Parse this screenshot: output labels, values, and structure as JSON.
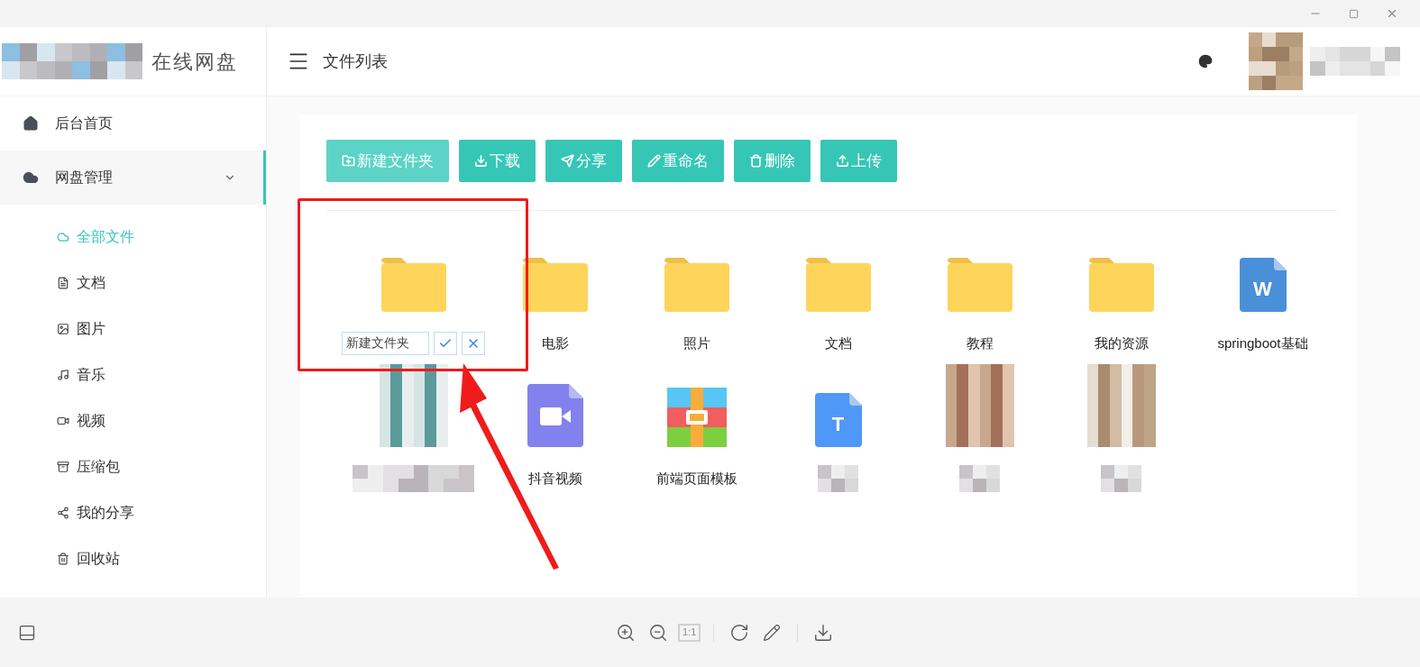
{
  "app": {
    "logo_text": "在线网盘"
  },
  "header": {
    "title": "文件列表"
  },
  "sidebar": {
    "items": [
      {
        "label": "后台首页",
        "selected": false
      },
      {
        "label": "网盘管理",
        "selected": true,
        "expanded": true,
        "children": [
          {
            "label": "全部文件",
            "selected": true
          },
          {
            "label": "文档",
            "selected": false
          },
          {
            "label": "图片",
            "selected": false
          },
          {
            "label": "音乐",
            "selected": false
          },
          {
            "label": "视频",
            "selected": false
          },
          {
            "label": "压缩包",
            "selected": false
          },
          {
            "label": "我的分享",
            "selected": false
          },
          {
            "label": "回收站",
            "selected": false
          }
        ]
      }
    ]
  },
  "toolbar": [
    {
      "label": "新建文件夹",
      "hovered": true
    },
    {
      "label": "下载",
      "hovered": false
    },
    {
      "label": "分享",
      "hovered": false
    },
    {
      "label": "重命名",
      "hovered": false
    },
    {
      "label": "删除",
      "hovered": false
    },
    {
      "label": "上传",
      "hovered": false
    }
  ],
  "files": [
    {
      "kind": "folder",
      "name": "新建文件夹",
      "editing": true,
      "name_hidden": false
    },
    {
      "kind": "folder",
      "name": "电影",
      "editing": false,
      "name_hidden": false
    },
    {
      "kind": "folder",
      "name": "照片",
      "editing": false,
      "name_hidden": false
    },
    {
      "kind": "folder",
      "name": "文档",
      "editing": false,
      "name_hidden": false
    },
    {
      "kind": "folder",
      "name": "教程",
      "editing": false,
      "name_hidden": false
    },
    {
      "kind": "folder",
      "name": "我的资源",
      "editing": false,
      "name_hidden": false
    },
    {
      "kind": "word",
      "badge": "W",
      "name": "springboot基础",
      "editing": false,
      "name_hidden": false
    },
    {
      "kind": "image",
      "editing": false,
      "name_hidden": true
    },
    {
      "kind": "video",
      "name": "抖音视频",
      "editing": false,
      "name_hidden": false
    },
    {
      "kind": "zip",
      "name": "前端页面模板",
      "editing": false,
      "name_hidden": false
    },
    {
      "kind": "text",
      "badge": "T",
      "editing": false,
      "name_hidden": true
    },
    {
      "kind": "image",
      "editing": false,
      "name_hidden": true
    },
    {
      "kind": "image",
      "editing": false,
      "name_hidden": true
    }
  ],
  "viewer_toolbar": [
    {
      "kind": "zoom-in",
      "disabled": false
    },
    {
      "kind": "zoom-out",
      "disabled": false
    },
    {
      "kind": "ratio",
      "label": "1:1",
      "disabled": true
    },
    {
      "kind": "divider"
    },
    {
      "kind": "rotate",
      "disabled": false
    },
    {
      "kind": "edit",
      "disabled": false
    },
    {
      "kind": "divider"
    },
    {
      "kind": "download",
      "disabled": false
    }
  ]
}
